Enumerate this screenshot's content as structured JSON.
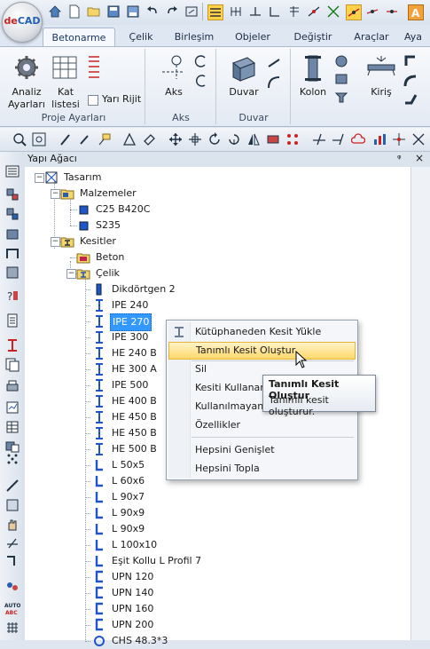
{
  "app": {
    "logo_de": "de",
    "logo_cad": "CAD"
  },
  "ribbon_tabs": [
    "Betonarme",
    "Çelik",
    "Birleşim",
    "Objeler",
    "Değiştir",
    "Araçlar",
    "Aya"
  ],
  "ribbon": {
    "analiz": "Analiz",
    "ayarlari": "Ayarları",
    "kat": "Kat",
    "listesi": "listesi",
    "yari_rijit": "Yarı Rijit",
    "proje_ayarlari": "Proje Ayarları",
    "aks": "Aks",
    "aks_group": "Aks",
    "duvar": "Duvar",
    "duvar_group": "Duvar",
    "kolon": "Kolon",
    "kiris": "Kiriş"
  },
  "panel": {
    "title": "Yapı Ağacı",
    "pin": "ᵠ",
    "close": "×"
  },
  "tree": {
    "tasarim": "Tasarım",
    "malzemeler": "Malzemeler",
    "mat1": "C25 B420C",
    "mat2": "S235",
    "kesitler": "Kesitler",
    "beton": "Beton",
    "celik": "Çelik",
    "items": [
      "Dikdörtgen 2",
      "IPE 240",
      "IPE 270",
      "IPE 300",
      "HE 240 B",
      "HE 300 A",
      "IPE 500",
      "HE 400 B",
      "HE 450 B",
      "HE 450 B",
      "HE 500 B",
      "L 50x5",
      "L 60x6",
      "L 90x7",
      "L 90x9",
      "L 90x9",
      "L 100x10",
      "Eşit Kollu L Profil 7",
      "UPN 120",
      "UPN 140",
      "UPN 160",
      "UPN 200",
      "CHS 48.3*3"
    ],
    "selected_index": 2
  },
  "context_menu": {
    "items": [
      "Kütüphaneden Kesit Yükle",
      "Tanımlı Kesit Oluştur",
      "Sil",
      "Kesiti Kullanara",
      "Kullanılmayan K",
      "Özellikler",
      "Hepsini Genişlet",
      "Hepsini Topla"
    ],
    "highlighted_index": 1
  },
  "tooltip": {
    "title": "Tanımlı Kesit Oluştur",
    "desc": "Tanımlı kesit oluşturur."
  },
  "colors": {
    "accent": "#3399ff",
    "highlight": "#ffd86a"
  }
}
